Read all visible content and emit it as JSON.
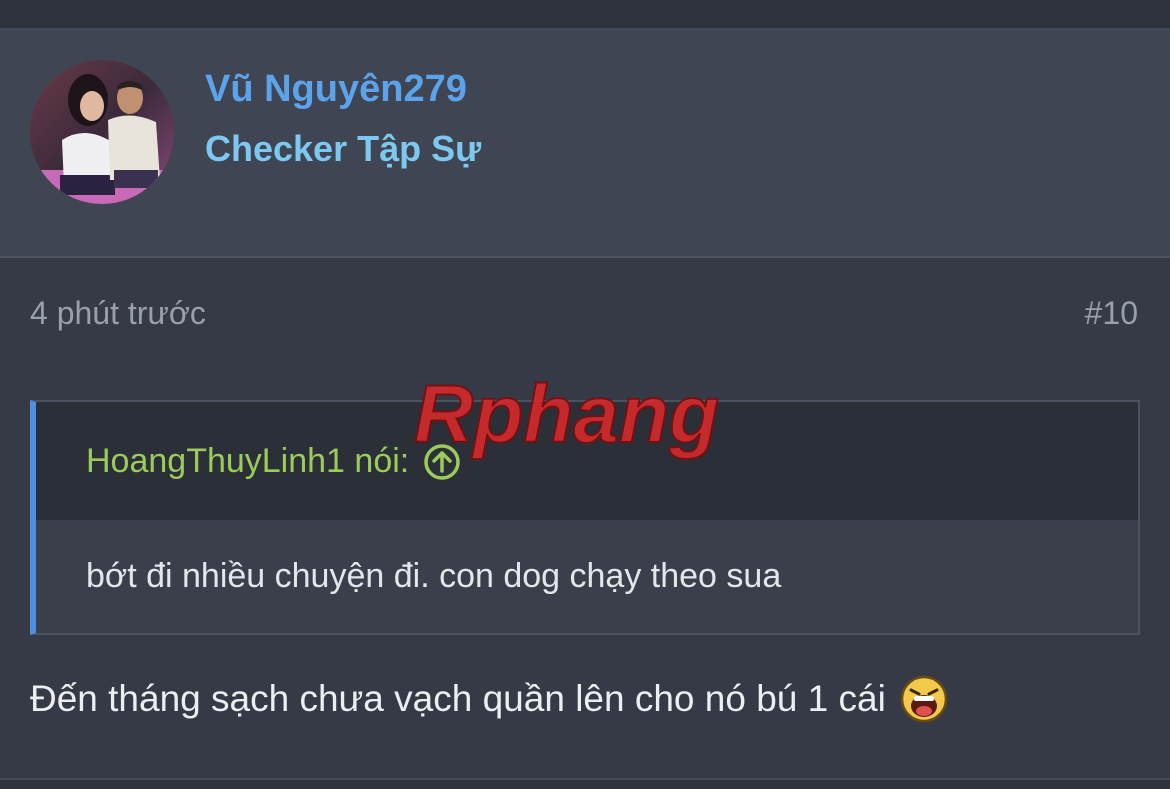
{
  "user": {
    "name": "Vũ Nguyên279",
    "title": "Checker Tập Sự"
  },
  "post": {
    "time": "4 phút trước",
    "number": "#10",
    "quote": {
      "author_line": "HoangThuyLinh1 nói:",
      "text": "bớt đi nhiều chuyện đi. con dog chạy theo sua"
    },
    "message": "Đến tháng sạch chưa vạch quần lên cho nó bú 1 cái",
    "emoji": "laughing-face-icon"
  },
  "watermark": {
    "text": "Rphang"
  },
  "colors": {
    "username": "#5ba4ec",
    "user_title": "#7cc8f0",
    "quote_author": "#9ccb5c",
    "quote_bar": "#4d8fe0",
    "background": "#353a46"
  }
}
